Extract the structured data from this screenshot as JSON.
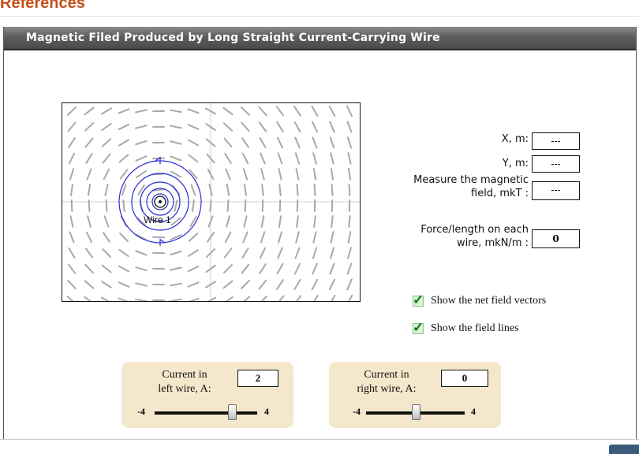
{
  "page": {
    "heading": "References"
  },
  "applet": {
    "title": "Magnetic Filed Produced by Long Straight Current-Carrying Wire",
    "wire_label": "Wire 1",
    "readouts": {
      "x_label": "X, m:",
      "x_value": "---",
      "y_label": "Y, m:",
      "y_value": "---",
      "measure_label_1": "Measure the magnetic",
      "measure_label_2": "field, mkT :",
      "measure_value": "---",
      "force_label_1": "Force/length on each",
      "force_label_2": "wire, mkN/m :",
      "force_value": "0"
    },
    "options": {
      "net_vectors": {
        "label": "Show the net field vectors",
        "checked": true
      },
      "field_lines": {
        "label": "Show the field lines",
        "checked": true
      }
    },
    "left_current": {
      "label_1": "Current in",
      "label_2": "left wire, A:",
      "value": "2",
      "min": "-4",
      "max": "4",
      "level": 0.75
    },
    "right_current": {
      "label_1": "Current in",
      "label_2": "right wire, A:",
      "value": "0",
      "min": "-4",
      "max": "4",
      "level": 0.5
    }
  },
  "colors": {
    "heading": "#c4501a",
    "field_lines": "#2a2ad6",
    "vectors": "#a8a8a8",
    "panel": "#f4e7cc",
    "check": "#0b7a0b"
  }
}
